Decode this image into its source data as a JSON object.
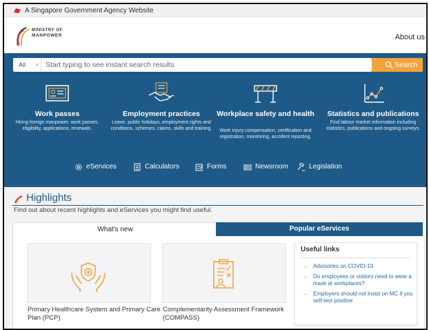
{
  "gov_banner": {
    "text": "A Singapore Government Agency Website"
  },
  "header": {
    "logo_line1": "MINISTRY OF",
    "logo_line2": "MANPOWER",
    "about_link": "About us"
  },
  "search": {
    "scope": "All",
    "placeholder": "Start typing to see instant search results",
    "button_label": "Search"
  },
  "categories": [
    {
      "title": "Work passes",
      "desc": "Hiring foreign manpower, work passes, eligibility, applications, renewals.",
      "icon": "id-card-icon"
    },
    {
      "title": "Employment practices",
      "desc": "Leave, public holidays, employment rights and conditions, schemes, claims, skills and training.",
      "icon": "handshake-icon"
    },
    {
      "title": "Workplace safety and health",
      "desc": "Work injury compensation, certification and registration, monitoring, accident reporting.",
      "icon": "barrier-icon"
    },
    {
      "title": "Statistics and publications",
      "desc": "Find labour market information including statistics, publications and ongoing surveys.",
      "icon": "chart-icon"
    }
  ],
  "quick_links": [
    {
      "label": "eServices",
      "icon": "gear-icon"
    },
    {
      "label": "Calculators",
      "icon": "calculator-icon"
    },
    {
      "label": "Forms",
      "icon": "form-icon"
    },
    {
      "label": "Newsroom",
      "icon": "newspaper-icon"
    },
    {
      "label": "Legislation",
      "icon": "gavel-icon"
    }
  ],
  "highlights": {
    "title": "Highlights",
    "subtitle": "Find out about recent highlights and eServices you might find useful.",
    "tabs": [
      "What's new",
      "Popular eServices"
    ],
    "cards": [
      {
        "caption": "Primary Healthcare System and Primary Care Plan (PCP)",
        "icon": "healthcare-hands-icon"
      },
      {
        "caption": "Complementarity Assessment Framework (COMPASS)",
        "icon": "checklist-person-icon"
      }
    ],
    "useful_links": {
      "heading": "Useful links",
      "items": [
        "Advisories on COVID-19",
        "Do employees or visitors need to wear a mask at workplaces?",
        "Employers should not insist on MC if you self-test positive"
      ]
    }
  },
  "colors": {
    "primary": "#1d5a87",
    "accent": "#f5a23a",
    "banner_red": "#e0262b"
  }
}
